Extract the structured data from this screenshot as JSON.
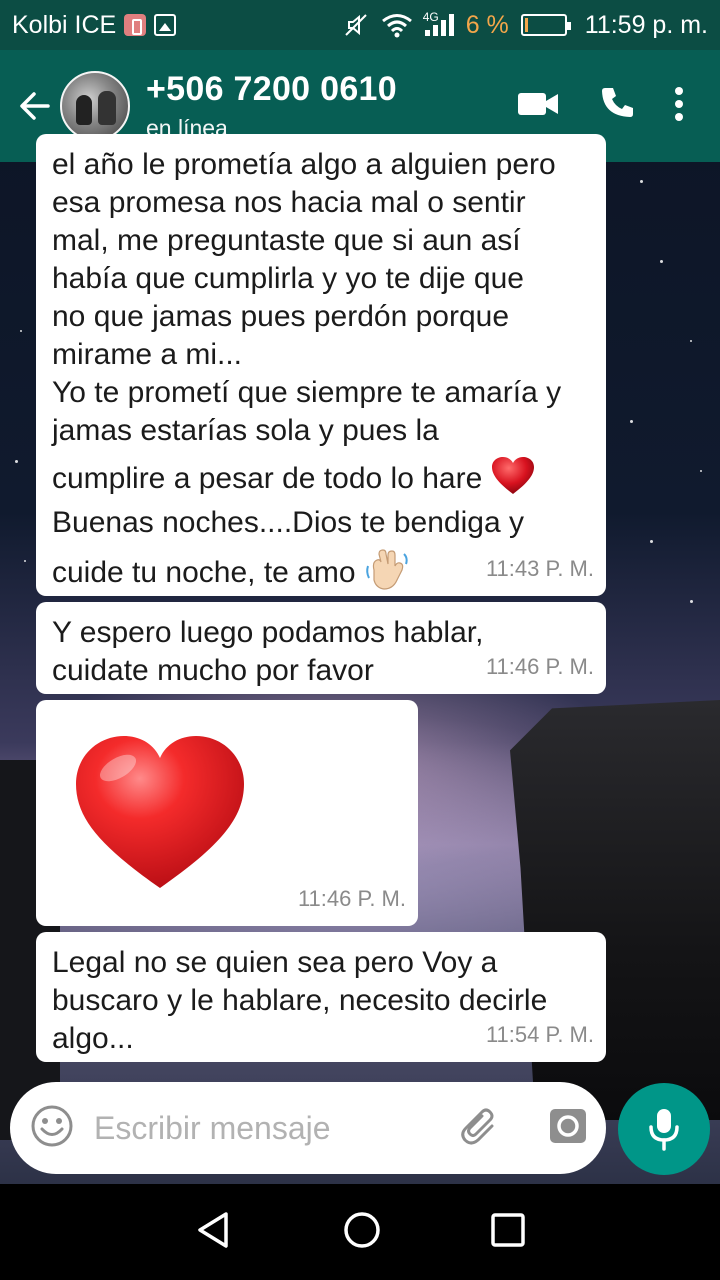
{
  "status_bar": {
    "carrier": "Kolbi ICE",
    "network": "4G",
    "battery_percent": "6 %",
    "time": "11:59 p. m."
  },
  "chat_header": {
    "contact_name": "+506 7200 0610",
    "contact_status": "en línea"
  },
  "messages": [
    {
      "lines": [
        "el año le prometía algo a alguien pero",
        "esa promesa nos hacia mal o sentir",
        "mal, me preguntaste que si aun así",
        "había que cumplirla y yo te dije que",
        "no que jamas pues perdón porque",
        "mirame a mi...",
        "Yo te prometí que siempre te amaría y",
        "jamas estarías sola y pues la",
        "cumplire a pesar de todo lo hare",
        "Buenas noches....Dios te bendiga y",
        "cuide tu noche, te amo"
      ],
      "time": "11:43 P. M."
    },
    {
      "lines": [
        "Y espero luego podamos hablar,",
        "cuidate mucho por favor"
      ],
      "time": "11:46 P. M."
    },
    {
      "sticker": "red-heart",
      "time": "11:46 P. M."
    },
    {
      "lines": [
        "Legal no se quien sea pero Voy a",
        "buscaro y le hablare, necesito decirle",
        "algo..."
      ],
      "time": "11:54 P. M."
    }
  ],
  "composer": {
    "placeholder": "Escribir mensaje"
  },
  "icons": {
    "back": "arrow-left-icon",
    "video_call": "video-camera-icon",
    "voice_call": "phone-icon",
    "menu": "more-vertical-icon",
    "emoji": "smiley-icon",
    "attach": "paperclip-icon",
    "camera": "camera-icon",
    "mic": "microphone-icon"
  },
  "colors": {
    "header": "#075e54",
    "status_bar": "#0c4d44",
    "mic_button": "#009688",
    "battery_low": "#f3a64a"
  }
}
